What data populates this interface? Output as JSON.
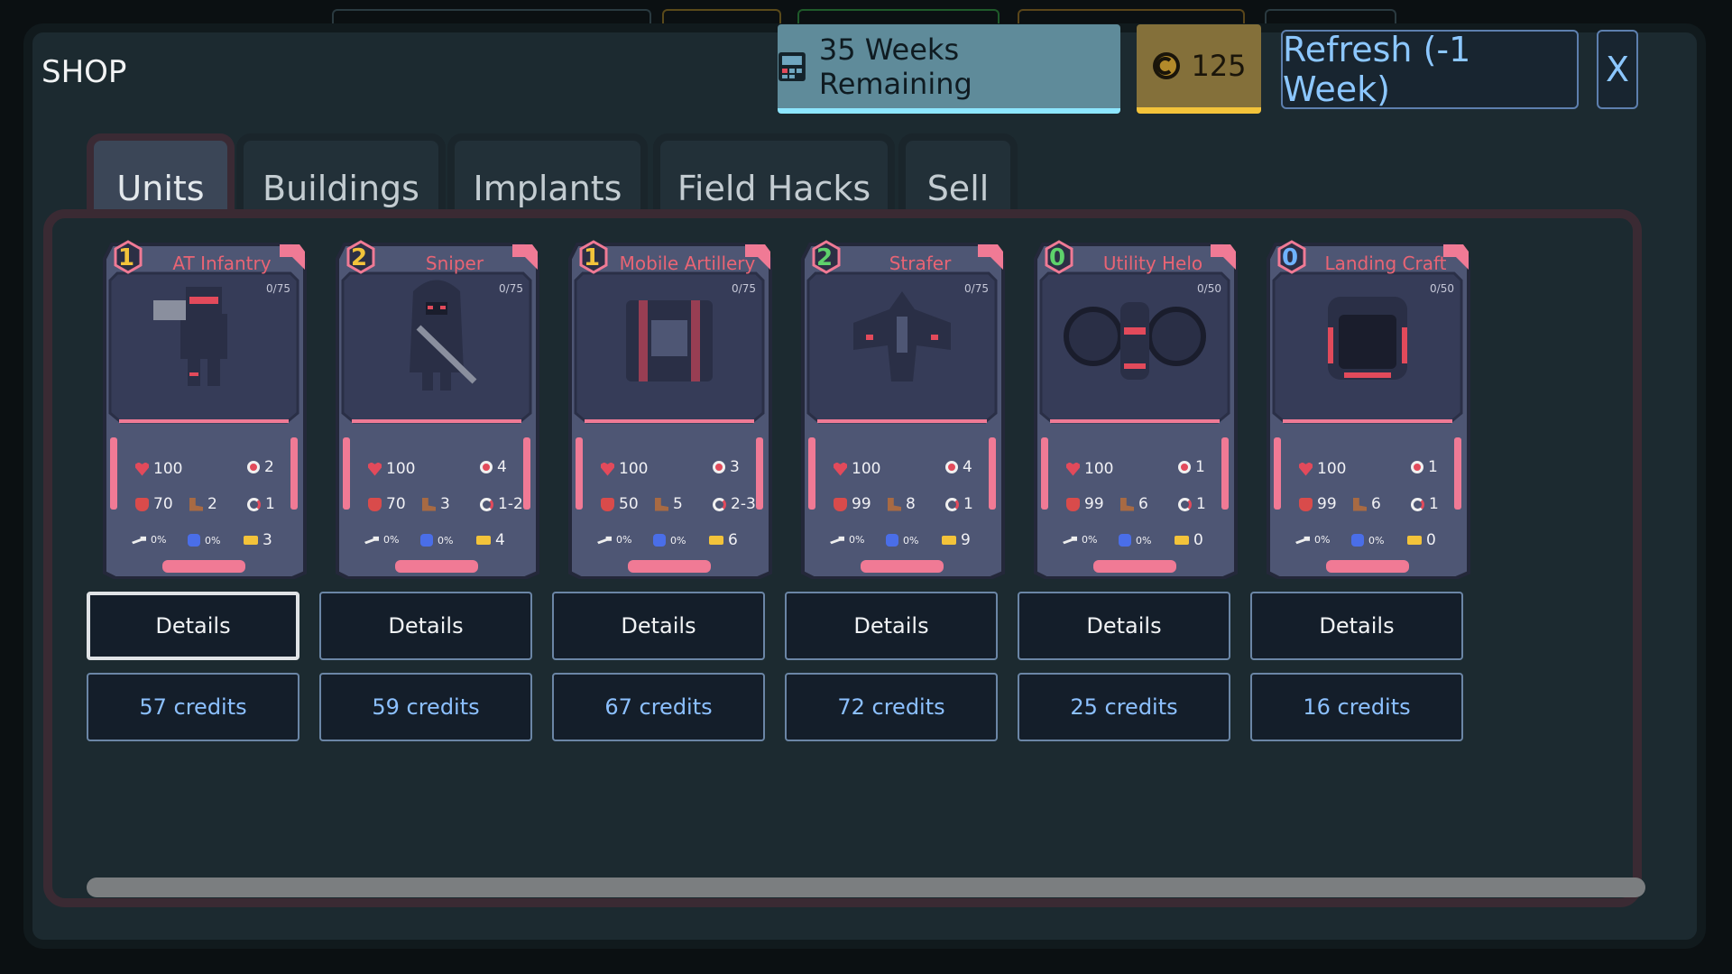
{
  "shop": {
    "title": "SHOP",
    "weeks_remaining": "35 Weeks Remaining",
    "credits": "125",
    "refresh_label": "Refresh (-1 Week)",
    "close_label": "X"
  },
  "tabs": [
    {
      "label": "Units",
      "active": true
    },
    {
      "label": "Buildings"
    },
    {
      "label": "Implants"
    },
    {
      "label": "Field Hacks"
    },
    {
      "label": "Sell"
    }
  ],
  "units": [
    {
      "name": "AT Infantry",
      "tier": "1",
      "tier_color": "#f3c33a",
      "capacity": "0/75",
      "hp": "100",
      "range": "2",
      "armor": "70",
      "move": "2",
      "attacks": "1",
      "accuracy": "0%",
      "evasion": "0%",
      "ammo": "3",
      "details_label": "Details",
      "price": "57 credits"
    },
    {
      "name": "Sniper",
      "tier": "2",
      "tier_color": "#f3c33a",
      "capacity": "0/75",
      "hp": "100",
      "range": "4",
      "armor": "70",
      "move": "3",
      "attacks": "1-2",
      "accuracy": "0%",
      "evasion": "0%",
      "ammo": "4",
      "details_label": "Details",
      "price": "59 credits"
    },
    {
      "name": "Mobile Artillery",
      "tier": "1",
      "tier_color": "#f3c33a",
      "capacity": "0/75",
      "hp": "100",
      "range": "3",
      "armor": "50",
      "move": "5",
      "attacks": "2-3",
      "accuracy": "0%",
      "evasion": "0%",
      "ammo": "6",
      "details_label": "Details",
      "price": "67 credits"
    },
    {
      "name": "Strafer",
      "tier": "2",
      "tier_color": "#5ed16b",
      "capacity": "0/75",
      "hp": "100",
      "range": "4",
      "armor": "99",
      "move": "8",
      "attacks": "1",
      "accuracy": "0%",
      "evasion": "0%",
      "ammo": "9",
      "details_label": "Details",
      "price": "72 credits"
    },
    {
      "name": "Utility Helo",
      "tier": "0",
      "tier_color": "#5ed16b",
      "capacity": "0/50",
      "hp": "100",
      "range": "1",
      "armor": "99",
      "move": "6",
      "attacks": "1",
      "accuracy": "0%",
      "evasion": "0%",
      "ammo": "0",
      "details_label": "Details",
      "price": "25 credits"
    },
    {
      "name": "Landing Craft",
      "tier": "0",
      "tier_color": "#6fb3ff",
      "capacity": "0/50",
      "hp": "100",
      "range": "1",
      "armor": "99",
      "move": "6",
      "attacks": "1",
      "accuracy": "0%",
      "evasion": "0%",
      "ammo": "0",
      "details_label": "Details",
      "price": "16 credits"
    }
  ]
}
